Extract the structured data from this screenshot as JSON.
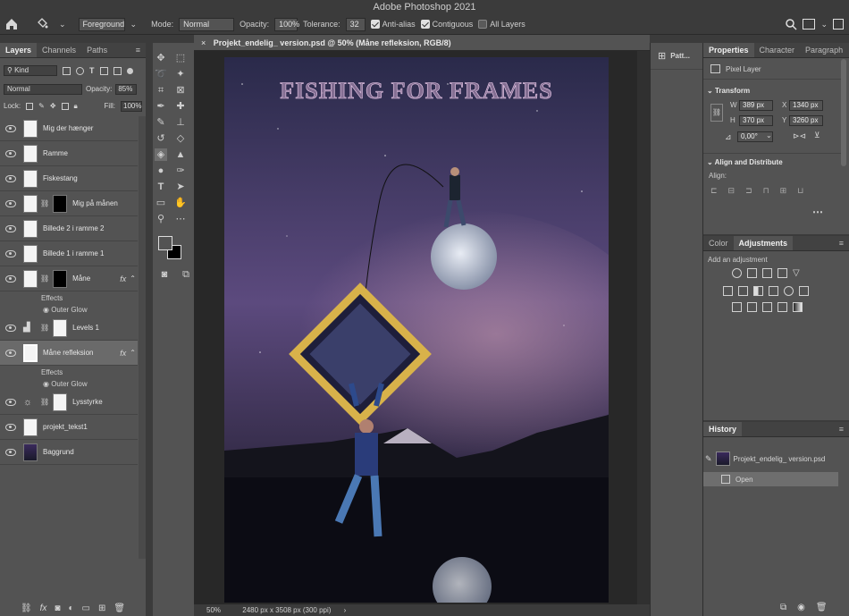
{
  "app": {
    "title": "Adobe Photoshop 2021"
  },
  "options_bar": {
    "foreground": "Foreground",
    "mode_label": "Mode:",
    "mode_value": "Normal",
    "opacity_label": "Opacity:",
    "opacity_value": "100%",
    "tolerance_label": "Tolerance:",
    "tolerance_value": "32",
    "anti_alias": "Anti-alias",
    "contiguous": "Contiguous",
    "all_layers": "All Layers"
  },
  "layers_panel": {
    "tabs": [
      "Layers",
      "Channels",
      "Paths"
    ],
    "kind_label": "Kind",
    "blend_mode": "Normal",
    "opacity_label": "Opacity:",
    "opacity_value": "85%",
    "lock_label": "Lock:",
    "fill_label": "Fill:",
    "fill_value": "100%",
    "layers": [
      {
        "name": "Mig der hænger"
      },
      {
        "name": "Ramme"
      },
      {
        "name": "Fiskestang"
      },
      {
        "name": "Mig på månen"
      },
      {
        "name": "Billede 2 i ramme 2"
      },
      {
        "name": "Billede 1 i ramme 1"
      },
      {
        "name": "Måne"
      },
      {
        "name": "Levels 1"
      },
      {
        "name": "Måne refleksion"
      },
      {
        "name": "Lysstyrke"
      },
      {
        "name": "projekt_tekst1"
      },
      {
        "name": "Baggrund"
      }
    ],
    "effects_label": "Effects",
    "outer_glow_label": "Outer Glow",
    "fx_label": "fx"
  },
  "document": {
    "tab_title": "Projekt_endelig_ version.psd @ 50% (Måne refleksion, RGB/8)",
    "canvas_title": "FISHING FOR FRAMES",
    "zoom": "50%",
    "dimensions": "2480 px x 3508 px (300 ppi)"
  },
  "patterns_panel": {
    "label": "Patt..."
  },
  "properties_panel": {
    "tabs": [
      "Properties",
      "Character",
      "Paragraph"
    ],
    "kind": "Pixel Layer",
    "transform_title": "Transform",
    "w_label": "W",
    "w_value": "389 px",
    "h_label": "H",
    "h_value": "370 px",
    "x_label": "X",
    "x_value": "1340 px",
    "y_label": "Y",
    "y_value": "3260 px",
    "angle_value": "0,00°",
    "align_title": "Align and Distribute",
    "align_label": "Align:"
  },
  "adjustments_panel": {
    "tabs": [
      "Color",
      "Adjustments"
    ],
    "add_label": "Add an adjustment"
  },
  "history_panel": {
    "title": "History",
    "snapshot": "Projekt_endelig_ version.psd",
    "open_label": "Open"
  },
  "colors": {
    "ui_dark": "#3b3b3b",
    "ui_panel": "#535353",
    "gold": "#d8b24a",
    "title_pink": "#c8a4c8"
  }
}
